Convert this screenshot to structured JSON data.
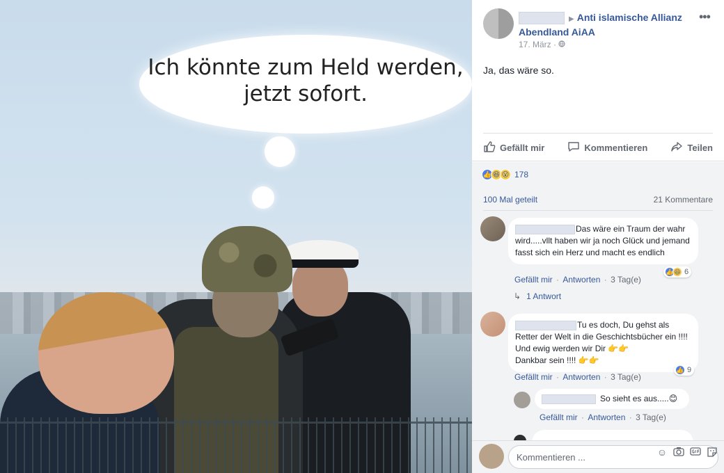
{
  "image": {
    "thought_bubble_line1": "Ich könnte zum Held werden,",
    "thought_bubble_line2": "jetzt sofort."
  },
  "post": {
    "page_name": "Anti islamische Allianz Abendland AiAA",
    "date": "17. März",
    "text": "Ja, das wäre so.",
    "actions": {
      "like": "Gefällt mir",
      "comment": "Kommentieren",
      "share": "Teilen"
    },
    "reaction_count": "178",
    "shares": "100 Mal geteilt",
    "comments_count": "21 Kommentare"
  },
  "comments": [
    {
      "text": "Das wäre ein Traum der wahr wird.....vllt haben wir ja noch Glück und jemand fasst sich ein Herz und macht es endlich",
      "like_label": "Gefällt mir",
      "reply_label": "Antworten",
      "time": "3 Tag(e)",
      "reactions": "6",
      "replies_link": "1 Antwort"
    },
    {
      "text_a": "Tu es doch, Du gehst als Retter der Welt in die Geschichtsbücher ein !!!! Und ewig werden wir Dir",
      "text_b": "Dankbar sein !!!!",
      "like_label": "Gefällt mir",
      "reply_label": "Antworten",
      "time": "3 Tag(e)",
      "reactions": "9"
    },
    {
      "text": "So sieht es aus.....",
      "like_label": "Gefällt mir",
      "reply_label": "Antworten",
      "time": "3 Tag(e)"
    }
  ],
  "composer": {
    "placeholder": "Kommentieren ..."
  },
  "icons": [
    "thumbs-up-icon",
    "comment-icon",
    "share-icon",
    "more-icon",
    "globe-icon",
    "reply-arrow-icon",
    "emoji-icon",
    "camera-icon",
    "gif-icon",
    "sticker-icon"
  ],
  "colors": {
    "link_blue": "#365899",
    "muted_gray": "#606770",
    "feed_background": "#f2f3f5",
    "like_blue": "#4b7bec"
  }
}
